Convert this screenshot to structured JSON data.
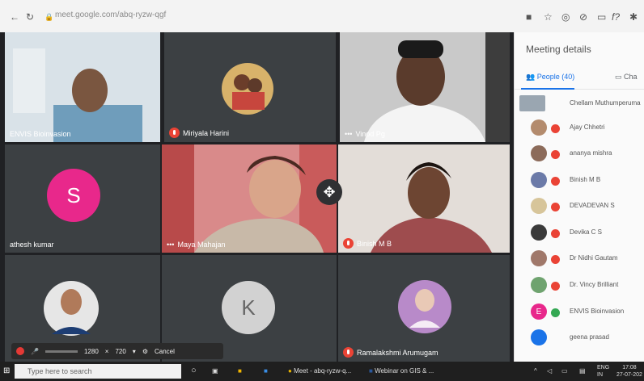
{
  "browser": {
    "url": "meet.google.com/abq-ryzw-qgf"
  },
  "tiles": [
    {
      "name": "ENVIS Bioinvasion"
    },
    {
      "name": "Miriyala Harini"
    },
    {
      "name": "Vinod Pg"
    },
    {
      "name": "athesh kumar",
      "letter": "S"
    },
    {
      "name": "Maya Mahajan"
    },
    {
      "name": "Binish M B"
    },
    {
      "name": ""
    },
    {
      "name": "",
      "letter": "K"
    },
    {
      "name": "Ramalakshmi Arumugam"
    }
  ],
  "sidebar": {
    "title": "Meeting details",
    "people_tab": "People (40)",
    "chat_tab": "Cha",
    "people": [
      "Chellam Muthumperuma",
      "Ajay Chhetri",
      "ananya mishra",
      "Binish M B",
      "DEVADEVAN S",
      "Devika C S",
      "Dr Nidhi Gautam",
      "Dr. Vincy Brilliant",
      "ENVIS Bioinvasion",
      "geena prasad"
    ]
  },
  "recorder": {
    "width": "1280",
    "height": "720",
    "cancel": "Cancel"
  },
  "taskbar": {
    "search_placeholder": "Type here to search",
    "meet_item": "Meet - abq-ryzw-q...",
    "word_item": "Webinar on GIS & ...",
    "lang": "ENG",
    "region": "IN",
    "time": "17:08",
    "date": "27-07-202"
  }
}
